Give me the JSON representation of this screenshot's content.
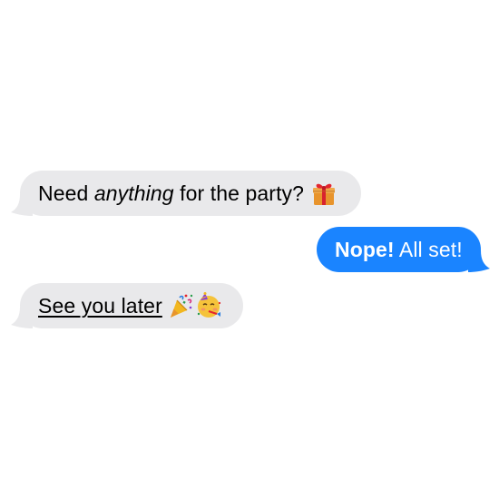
{
  "messages": [
    {
      "direction": "incoming",
      "parts": {
        "pre": "Need ",
        "emphasis": "anything",
        "post": " for the party? "
      },
      "emoji": [
        "gift-icon"
      ]
    },
    {
      "direction": "outgoing",
      "parts": {
        "bold": "Nope!",
        "rest": " All set!"
      }
    },
    {
      "direction": "incoming",
      "parts": {
        "link": "See you later",
        "post": " "
      },
      "emoji": [
        "party-popper-icon",
        "partying-face-icon"
      ]
    }
  ],
  "colors": {
    "incoming_bubble": "#e9e9eb",
    "outgoing_bubble": "#1a84ff",
    "incoming_text": "#000000",
    "outgoing_text": "#ffffff"
  }
}
